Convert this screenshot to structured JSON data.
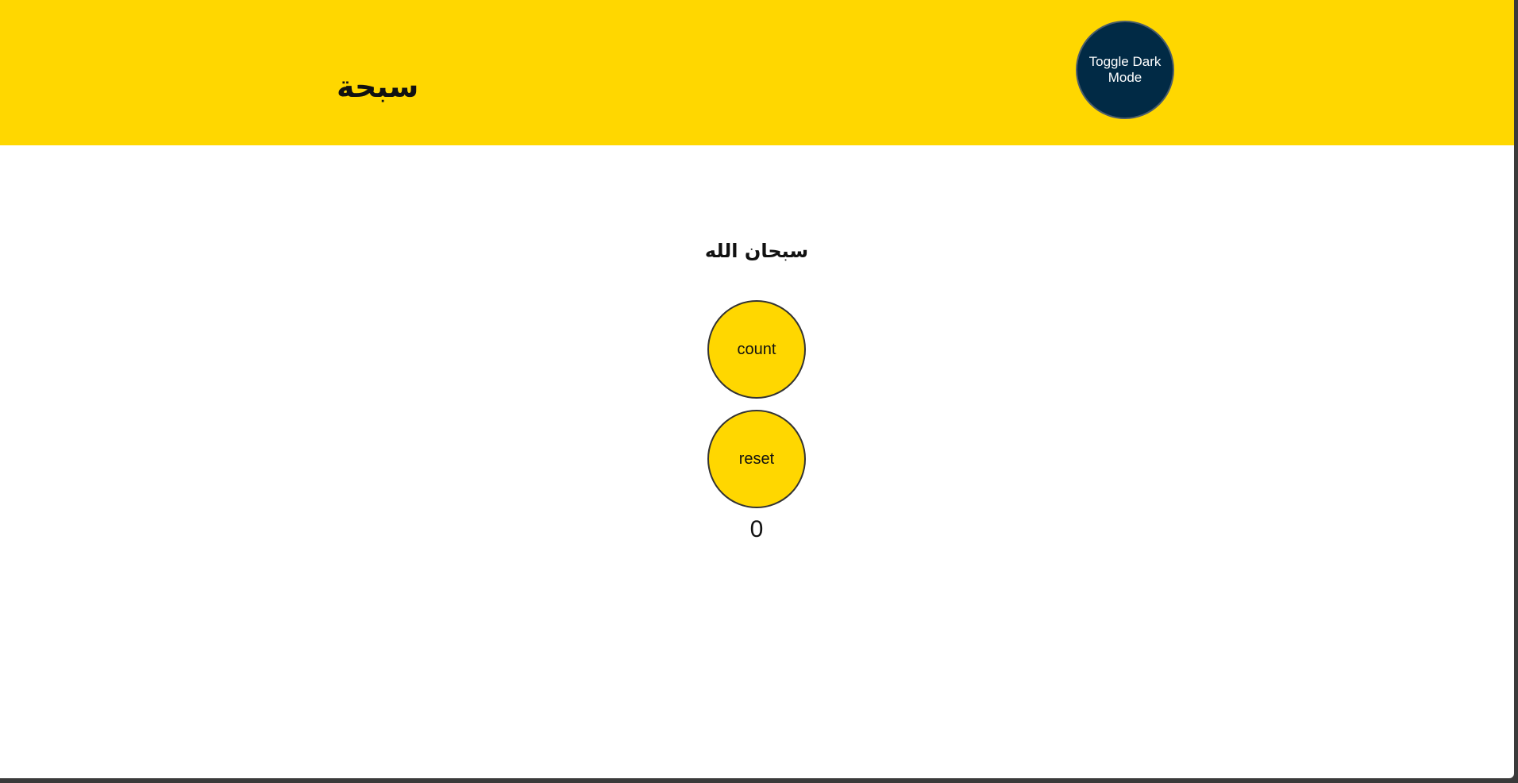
{
  "header": {
    "title": "سبحة",
    "toggle_label": "Toggle Dark Mode"
  },
  "main": {
    "dhikr": "سبحان الله",
    "count_label": "count",
    "reset_label": "reset",
    "counter": "0"
  },
  "colors": {
    "accent": "#FFD700",
    "toggle_background": "#012A45",
    "page_background": "#FFFFFF",
    "text": "#111111"
  }
}
